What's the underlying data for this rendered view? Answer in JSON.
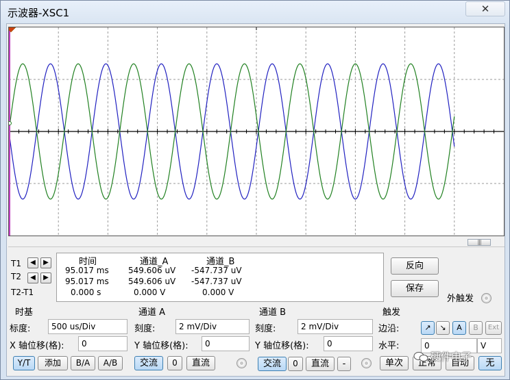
{
  "window": {
    "title": "示波器-XSC1",
    "close_glyph": "✕"
  },
  "scope": {
    "colors": {
      "channel_a": "#2020c0",
      "channel_b": "#208020",
      "cursor_t1": "#c040c0",
      "grid": "#9a9a9a",
      "axis": "#000000",
      "background": "#ffffff"
    },
    "grid_divisions": {
      "x": 10,
      "y": 4
    },
    "cursor_marker_icon": "triangle-down-icon",
    "scroll_thumb_glyph": "|||"
  },
  "chart_data": {
    "type": "line",
    "x_unit": "us",
    "x_range": [
      0,
      5000
    ],
    "y_unit": "mV",
    "y_range": [
      -4,
      4
    ],
    "grid": true,
    "series": [
      {
        "name": "通道_A",
        "color": "#2020c0",
        "amplitude": 2.6,
        "period": 560,
        "phase_deg": 180
      },
      {
        "name": "通道_B",
        "color": "#208020",
        "amplitude": 2.6,
        "period": 560,
        "phase_deg": 0
      }
    ],
    "trace_end_us": 4500
  },
  "readout": {
    "headers": {
      "time": "时间",
      "ch_a": "通道_A",
      "ch_b": "通道_B"
    },
    "rows": [
      {
        "label": "T1",
        "time": "95.017 ms",
        "ch_a": "549.606 uV",
        "ch_b": "-547.737 uV"
      },
      {
        "label": "T2",
        "time": "95.017 ms",
        "ch_a": "549.606 uV",
        "ch_b": "-547.737 uV"
      },
      {
        "label": "T2-T1",
        "time": "0.000 s",
        "ch_a": "0.000 V",
        "ch_b": "0.000 V"
      }
    ],
    "arrow_left": "◀",
    "arrow_right": "▶"
  },
  "side_buttons": {
    "reverse": "反向",
    "save": "保存",
    "ext_trigger": "外触发"
  },
  "timebase": {
    "title": "时基",
    "scale_label": "标度:",
    "scale_value": "500 us/Div",
    "xpos_label": "X 轴位移(格):",
    "xpos_value": "0",
    "modes": [
      "Y/T",
      "添加",
      "B/A",
      "A/B"
    ]
  },
  "channel_a": {
    "title": "通道 A",
    "scale_label": "刻度:",
    "scale_value": "2 mV/Div",
    "ypos_label": "Y 轴位移(格):",
    "ypos_value": "0",
    "coupling": [
      "交流",
      "0",
      "直流"
    ]
  },
  "channel_b": {
    "title": "通道 B",
    "scale_label": "刻度:",
    "scale_value": "2 mV/Div",
    "ypos_label": "Y 轴位移(格):",
    "ypos_value": "0",
    "coupling": [
      "交流",
      "0",
      "直流",
      "-"
    ]
  },
  "trigger": {
    "title": "触发",
    "edge_label": "边沿:",
    "edge_rise": "↗",
    "edge_fall": "↘",
    "sources": [
      "A",
      "B",
      "Ext"
    ],
    "level_label": "水平:",
    "level_value": "0",
    "level_unit": "V",
    "modes": [
      "单次",
      "正常",
      "自动",
      "无"
    ]
  },
  "watermark": {
    "text": "硬件电子",
    "icon": "wechat-icon"
  }
}
